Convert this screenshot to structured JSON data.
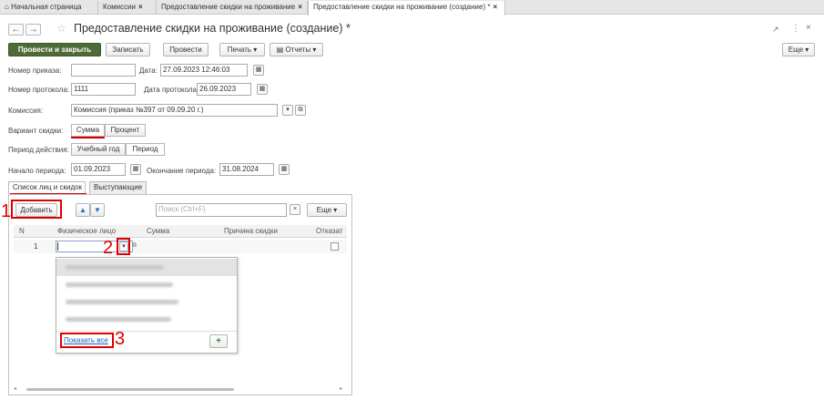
{
  "tabs": [
    {
      "label": "Начальная страница",
      "closable": false
    },
    {
      "label": "Комиссии",
      "closable": true
    },
    {
      "label": "Предоставление скидки на проживание",
      "closable": true
    },
    {
      "label": "Предоставление скидки на проживание (создание) *",
      "closable": true,
      "active": true
    }
  ],
  "close_glyph": "×",
  "home_glyph": "⌂",
  "nav": {
    "back": "←",
    "forward": "→",
    "star": "☆"
  },
  "title": "Предоставление скидки на проживание (создание) *",
  "window_icons": {
    "link": "🔗",
    "more": "⋮",
    "close": "×"
  },
  "toolbar": {
    "post_close": "Провести и закрыть",
    "save": "Записать",
    "post": "Провести",
    "print": "Печать",
    "reports": "Отчеты",
    "more": "Еще"
  },
  "form": {
    "order_no_label": "Номер приказа:",
    "order_no": "",
    "date_label": "Дата:",
    "date": "27.09.2023 12:46:03",
    "protocol_no_label": "Номер протокола:",
    "protocol_no": "1111",
    "protocol_date_label": "Дата протокола:",
    "protocol_date": "26.09.2023",
    "commission_label": "Комиссия:",
    "commission": "Комиссия (приказ №397 от 09.09.20 г.)",
    "discount_variant_label": "Вариант скидки:",
    "variant_sum": "Сумма",
    "variant_percent": "Процент",
    "period_label": "Период действия:",
    "period_year": "Учебный год",
    "period_period": "Период",
    "start_label": "Начало периода:",
    "start": "01.09.2023",
    "end_label": "Окончание периода:",
    "end": "31.08.2024"
  },
  "inner_tabs": [
    "Список лиц и скидок",
    "Выступающие"
  ],
  "table_toolbar": {
    "add": "Добавить",
    "search_placeholder": "Поиск (Ctrl+F)",
    "more": "Еще"
  },
  "columns": [
    "N",
    "Физическое лицо",
    "Сумма",
    "Причина скидки",
    "Отказат"
  ],
  "rows": [
    {
      "n": "1",
      "person": "",
      "sum": "",
      "reason": ""
    }
  ],
  "dropdown": {
    "show_all": "Показать все",
    "add_glyph": "+"
  },
  "markers": [
    "1",
    "2",
    "3"
  ],
  "colors": {
    "accent_green": "#4e6a36",
    "annotation_red": "#e00000",
    "link_blue": "#1a5fb4"
  }
}
